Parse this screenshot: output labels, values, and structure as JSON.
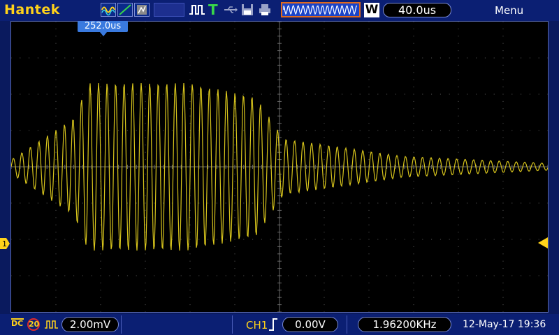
{
  "brand": "Hantek",
  "header": {
    "timebase": "40.0us",
    "w_label": "W",
    "menu_label": "Menu",
    "trigger_t": "T"
  },
  "trigger_position": "252.0us",
  "channel_marker": "1",
  "footer": {
    "coupling": "DC",
    "bw_limit": "20",
    "volts_per_div": "2.00mV",
    "channel": "CH1",
    "trigger_level": "0.00V",
    "frequency": "1.96200KHz",
    "datetime": "12-May-17 19:36"
  },
  "colors": {
    "trace": "#d8c51c",
    "accent": "#ffd21a",
    "background": "#000000"
  }
}
